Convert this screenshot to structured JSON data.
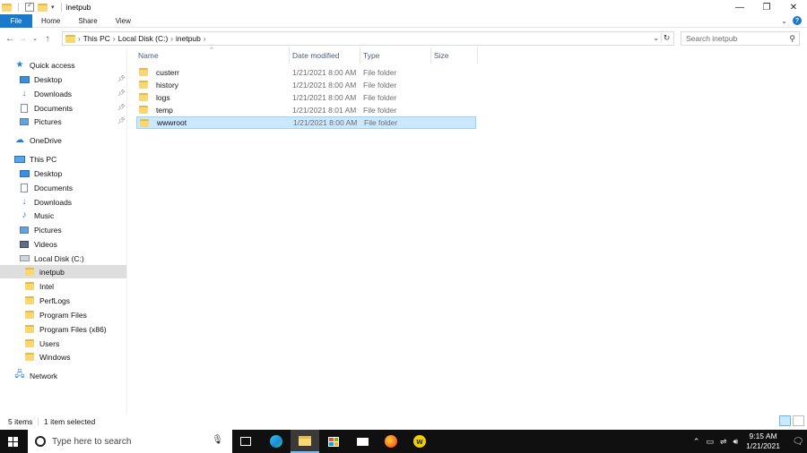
{
  "window": {
    "title": "inetpub"
  },
  "ribbon": {
    "tabs": [
      "File",
      "Home",
      "Share",
      "View"
    ]
  },
  "address": {
    "crumbs": [
      "This PC",
      "Local Disk (C:)",
      "inetpub"
    ],
    "separator": "›"
  },
  "search": {
    "placeholder": "Search inetpub"
  },
  "nav": {
    "quick_access": "Quick access",
    "qa_items": [
      "Desktop",
      "Downloads",
      "Documents",
      "Pictures"
    ],
    "onedrive": "OneDrive",
    "this_pc": "This PC",
    "pc_items": [
      "Desktop",
      "Documents",
      "Downloads",
      "Music",
      "Pictures",
      "Videos",
      "Local Disk (C:)"
    ],
    "disk_items": [
      "inetpub",
      "Intel",
      "PerfLogs",
      "Program Files",
      "Program Files (x86)",
      "Users",
      "Windows"
    ],
    "network": "Network"
  },
  "columns": {
    "name": "Name",
    "date": "Date modified",
    "type": "Type",
    "size": "Size"
  },
  "files": [
    {
      "name": "custerr",
      "date": "1/21/2021 8:00 AM",
      "type": "File folder"
    },
    {
      "name": "history",
      "date": "1/21/2021 8:00 AM",
      "type": "File folder"
    },
    {
      "name": "logs",
      "date": "1/21/2021 8:00 AM",
      "type": "File folder"
    },
    {
      "name": "temp",
      "date": "1/21/2021 8:01 AM",
      "type": "File folder"
    },
    {
      "name": "wwwroot",
      "date": "1/21/2021 8:00 AM",
      "type": "File folder"
    }
  ],
  "status": {
    "count": "5 items",
    "selected": "1 item selected"
  },
  "taskbar": {
    "search_placeholder": "Type here to search",
    "time": "9:15 AM",
    "date": "1/21/2021"
  },
  "colors": {
    "accent": "#1979ca",
    "selection": "#cce8ff",
    "taskbar": "#101010"
  }
}
